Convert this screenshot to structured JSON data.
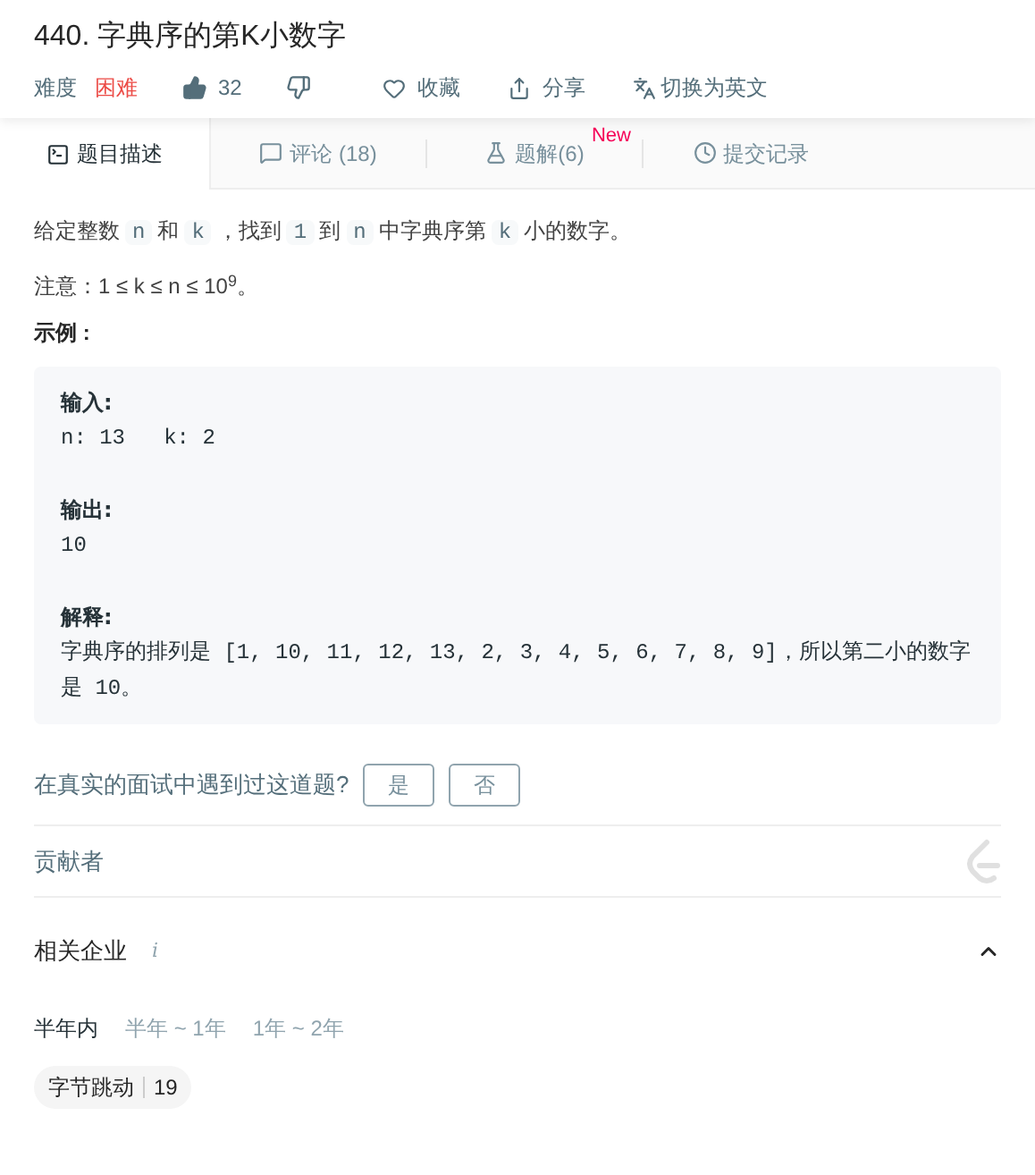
{
  "title": "440. 字典序的第K小数字",
  "meta": {
    "difficulty_label": "难度",
    "difficulty": "困难",
    "likes": "32",
    "favorite": "收藏",
    "share": "分享",
    "translate": "切换为英文"
  },
  "tabs": [
    {
      "label": "题目描述",
      "selected": true
    },
    {
      "label": "评论 (18)",
      "selected": false
    },
    {
      "label": "题解(6)",
      "selected": false,
      "badge": "New"
    },
    {
      "label": "提交记录",
      "selected": false
    }
  ],
  "description": [
    {
      "kind": "text",
      "text": "给定整数"
    },
    {
      "kind": "code",
      "text": "n"
    },
    {
      "kind": "text",
      "text": "和"
    },
    {
      "kind": "code",
      "text": "k"
    },
    {
      "kind": "text",
      "text": "，找到"
    },
    {
      "kind": "code",
      "text": "1"
    },
    {
      "kind": "text",
      "text": "到"
    },
    {
      "kind": "code",
      "text": "n"
    },
    {
      "kind": "text",
      "text": "中字典序第"
    },
    {
      "kind": "code",
      "text": "k"
    },
    {
      "kind": "text",
      "text": "小的数字。"
    }
  ],
  "note": "注意：1 ≤ k ≤ n ≤ 10$^{9}$。",
  "example_heading": "示例 :",
  "example": [
    {
      "label": "输入:",
      "body": "n: 13   k: 2"
    },
    {
      "label": "输出:",
      "body": "10"
    },
    {
      "label": "解释:",
      "body": "字典序的排列是 [1, 10, 11, 12, 13, 2, 3, 4, 5, 6, 7, 8, 9]，所以第二小的数字是 10。"
    }
  ],
  "interview": {
    "question": "在真实的面试中遇到过这道题?",
    "buttons": [
      "是",
      "否"
    ]
  },
  "contributors": "贡献者",
  "companies": {
    "title": "相关企业",
    "info": "i",
    "expanded": true,
    "periods": [
      {
        "label": "半年内",
        "selected": true
      },
      {
        "label": "半年 ~ 1年",
        "selected": false
      },
      {
        "label": "1年 ~ 2年",
        "selected": false
      }
    ],
    "tags": [
      {
        "name": "字节跳动",
        "count": "19"
      }
    ]
  }
}
